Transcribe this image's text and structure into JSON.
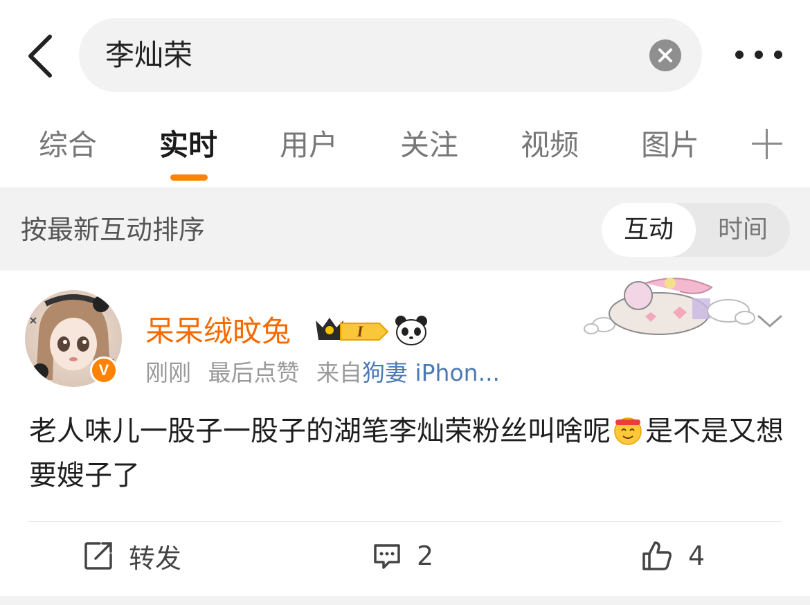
{
  "search": {
    "query": "李灿荣"
  },
  "tabs": [
    {
      "label": "综合"
    },
    {
      "label": "实时"
    },
    {
      "label": "用户"
    },
    {
      "label": "关注"
    },
    {
      "label": "视频"
    },
    {
      "label": "图片"
    }
  ],
  "sort": {
    "label": "按最新互动排序",
    "options": [
      {
        "label": "互动",
        "selected": true
      },
      {
        "label": "时间",
        "selected": false
      }
    ]
  },
  "post": {
    "username": "呆呆绒旼兔",
    "badge_level": "I",
    "time": "刚刚",
    "activity": "最后点赞",
    "source_prefix": "来自",
    "source": "狗妻 iPhon...",
    "text_part1": "老人味儿一股子一股子的湖笔李灿荣粉丝叫啥呢",
    "text_part2": "是不是又想要嫂子了",
    "actions": {
      "repost_label": "转发",
      "comment_count": "2",
      "like_count": "4"
    }
  },
  "colors": {
    "accent": "#ff8200",
    "username": "#f56a00",
    "source_link": "#4b79b5"
  },
  "icons": [
    "back-icon",
    "clear-icon",
    "more-icon",
    "plus-icon",
    "verified-icon",
    "crown-badge-icon",
    "panda-icon",
    "chevron-down-icon",
    "repost-icon",
    "comment-icon",
    "like-icon",
    "emoji-icon"
  ]
}
